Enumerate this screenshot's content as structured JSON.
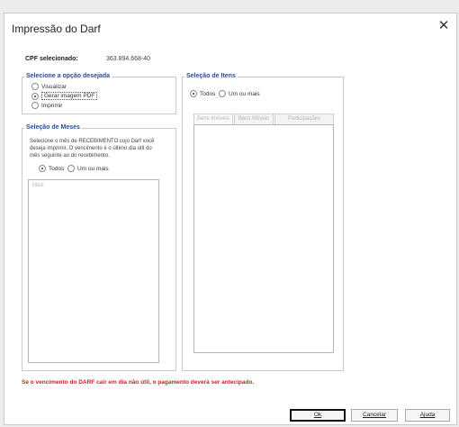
{
  "window": {
    "title": "Impressão do Darf",
    "close_glyph": "✕"
  },
  "cpf": {
    "label": "CPF selecionado:",
    "value": "363.894.668-40"
  },
  "option_group": {
    "legend": "Selecione a opção desejada",
    "options": [
      {
        "label": "Visualizar",
        "selected": false
      },
      {
        "label": "Gerar imagem PDF",
        "selected": true
      },
      {
        "label": "Imprimir",
        "selected": false
      }
    ]
  },
  "months_group": {
    "legend": "Seleção de Meses",
    "description": "Selecione o mês de RECEBIMENTO cujo Darf você deseja imprimir. O vencimento é o último dia útil do mês seguinte ao do recebimento.",
    "scope_options": [
      {
        "label": "Todos",
        "selected": true
      },
      {
        "label": "Um ou mais",
        "selected": false
      }
    ],
    "list_placeholder": "Mais"
  },
  "items_group": {
    "legend": "Seleção de Itens",
    "scope_options": [
      {
        "label": "Todos",
        "selected": true
      },
      {
        "label": "Um ou mais",
        "selected": false
      }
    ],
    "tabs": [
      {
        "label": "Bens Imóveis",
        "active": true
      },
      {
        "label": "Bens Móveis",
        "active": false
      },
      {
        "label": "Participações Societárias",
        "active": false
      }
    ]
  },
  "warning_text": "Se o vencimento do DARF cair em dia não útil, o pagamento deverá ser antecipado.",
  "buttons": {
    "ok": "Ok",
    "cancel": "Cancelar",
    "help": "Ajuda"
  },
  "colors": {
    "legend": "#2b4f8c",
    "warning": "#d12020"
  }
}
